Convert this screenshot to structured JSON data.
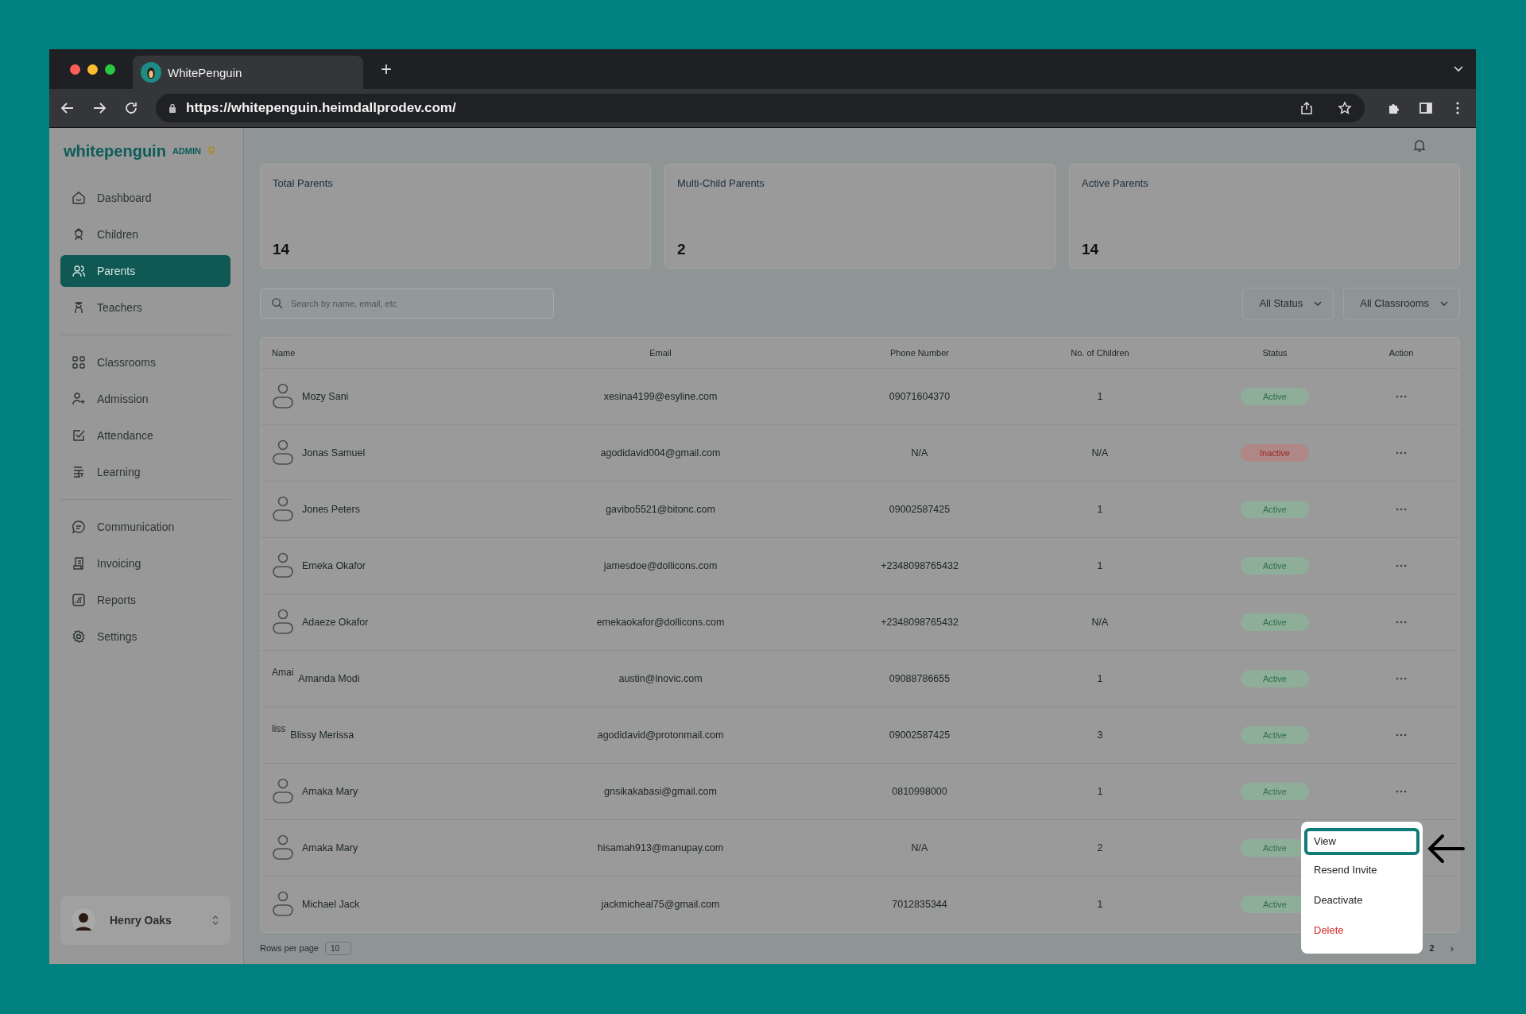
{
  "browser": {
    "tab_title": "WhitePenguin",
    "new_tab": "+",
    "url": "https://whitepenguin.heimdallprodev.com/"
  },
  "sidebar": {
    "logo": "whitepenguin",
    "role": "ADMIN",
    "groups": [
      [
        {
          "label": "Dashboard",
          "selected": false
        },
        {
          "label": "Children",
          "selected": false
        },
        {
          "label": "Parents",
          "selected": true
        },
        {
          "label": "Teachers",
          "selected": false
        }
      ],
      [
        {
          "label": "Classrooms",
          "selected": false
        },
        {
          "label": "Admission",
          "selected": false
        },
        {
          "label": "Attendance",
          "selected": false
        },
        {
          "label": "Learning",
          "selected": false
        }
      ],
      [
        {
          "label": "Communication",
          "selected": false
        },
        {
          "label": "Invoicing",
          "selected": false
        },
        {
          "label": "Reports",
          "selected": false
        },
        {
          "label": "Settings",
          "selected": false
        }
      ]
    ],
    "user": "Henry Oaks"
  },
  "stats": [
    {
      "label": "Total Parents",
      "value": "14"
    },
    {
      "label": "Multi-Child Parents",
      "value": "2"
    },
    {
      "label": "Active Parents",
      "value": "14"
    }
  ],
  "search": {
    "placeholder": "Search by name, email, etc"
  },
  "filters": [
    "All Status",
    "All Classrooms"
  ],
  "table": {
    "columns": [
      "Name",
      "Email",
      "Phone Number",
      "No. of Children",
      "Status",
      "Action"
    ],
    "rows": [
      {
        "avatar": {
          "kind": "icon"
        },
        "name": "Mozy Sani",
        "email": "xesina4199@esyline.com",
        "phone": "09071604370",
        "children": "1",
        "status": "Active",
        "active": true
      },
      {
        "avatar": {
          "kind": "icon"
        },
        "name": "Jonas Samuel",
        "email": "agodidavid004@gmail.com",
        "phone": "N/A",
        "children": "N/A",
        "status": "Inactive",
        "active": false
      },
      {
        "avatar": {
          "kind": "icon"
        },
        "name": "Jones Peters",
        "email": "gavibo5521@bitonc.com",
        "phone": "09002587425",
        "children": "1",
        "status": "Active",
        "active": true
      },
      {
        "avatar": {
          "kind": "icon"
        },
        "name": "Emeka Okafor",
        "email": "jamesdoe@dollicons.com",
        "phone": "+2348098765432",
        "children": "1",
        "status": "Active",
        "active": true
      },
      {
        "avatar": {
          "kind": "icon"
        },
        "name": "Adaeze Okafor",
        "email": "emekaokafor@dollicons.com",
        "phone": "+2348098765432",
        "children": "N/A",
        "status": "Active",
        "active": true
      },
      {
        "avatar": {
          "kind": "alt",
          "text": "Amai"
        },
        "name": "Amanda Modi",
        "email": "austin@lnovic.com",
        "phone": "09088786655",
        "children": "1",
        "status": "Active",
        "active": true
      },
      {
        "avatar": {
          "kind": "alt",
          "text": "liss"
        },
        "name": "Blissy Merissa",
        "email": "agodidavid@protonmail.com",
        "phone": "09002587425",
        "children": "3",
        "status": "Active",
        "active": true
      },
      {
        "avatar": {
          "kind": "icon"
        },
        "name": "Amaka Mary",
        "email": "gnsikakabasi@gmail.com",
        "phone": "0810998000",
        "children": "1",
        "status": "Active",
        "active": true
      },
      {
        "avatar": {
          "kind": "icon"
        },
        "name": "Amaka Mary",
        "email": "hisamah913@manupay.com",
        "phone": "N/A",
        "children": "2",
        "status": "Active",
        "active": true
      },
      {
        "avatar": {
          "kind": "icon"
        },
        "name": "Michael Jack",
        "email": "jackmicheal75@gmail.com",
        "phone": "7012835344",
        "children": "1",
        "status": "Active",
        "active": true
      }
    ]
  },
  "pagination": {
    "rows_label": "Rows per page",
    "rows_value": "10",
    "page": "2",
    "next": "›"
  },
  "action_menu": [
    {
      "label": "View",
      "selected": true,
      "danger": false
    },
    {
      "label": "Resend Invite",
      "selected": false,
      "danger": false
    },
    {
      "label": "Deactivate",
      "selected": false,
      "danger": false
    },
    {
      "label": "Delete",
      "selected": false,
      "danger": true
    }
  ]
}
